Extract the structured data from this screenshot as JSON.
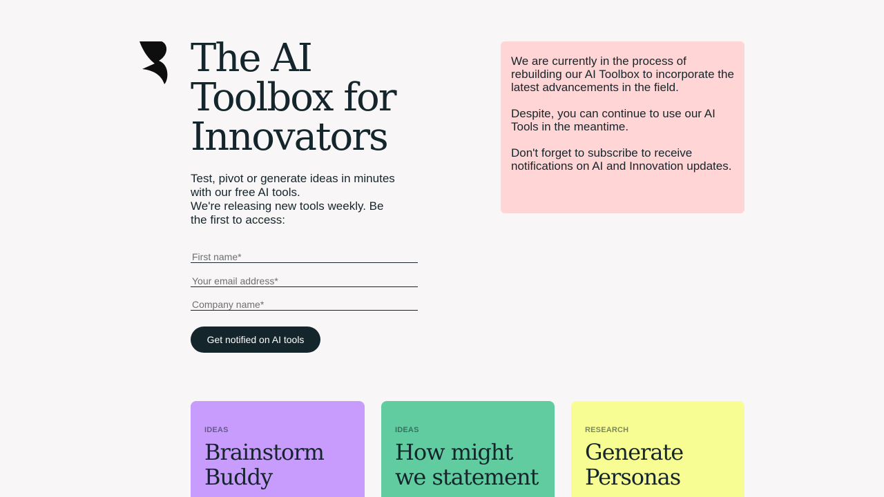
{
  "hero": {
    "title": "The AI Toolbox for Innovators",
    "intro_line_1": "Test, pivot or generate ideas in minutes with our free AI tools.",
    "intro_line_2": "We're releasing new tools weekly. Be the first to access:"
  },
  "form": {
    "first_name_placeholder": "First name*",
    "email_placeholder": "Your email address*",
    "company_placeholder": "Company name*",
    "submit_label": "Get notified on AI tools"
  },
  "notice": {
    "paragraph_1": "We are currently in the process of rebuilding our AI Toolbox to incorporate the latest advancements in the field.",
    "paragraph_2": "Despite, you can continue to use our AI Tools in the meantime.",
    "paragraph_3": "Don't forget to subscribe to receive notifications on AI and Innovation updates."
  },
  "cards": [
    {
      "tag": "IDEAS",
      "title": "Brainstorm Buddy ",
      "color": "#c89cfc"
    },
    {
      "tag": "IDEAS",
      "title": "How might we statement ",
      "color": "#60cca0"
    },
    {
      "tag": "RESEARCH",
      "title": "Generate Personas ",
      "color": "#f7fd92"
    }
  ],
  "colors": {
    "background": "#f8f6f6",
    "text": "#14252b",
    "notice_background": "#ffd5d5",
    "button_background": "#14252b"
  },
  "icons": {
    "logo": "brand-logo-icon"
  }
}
